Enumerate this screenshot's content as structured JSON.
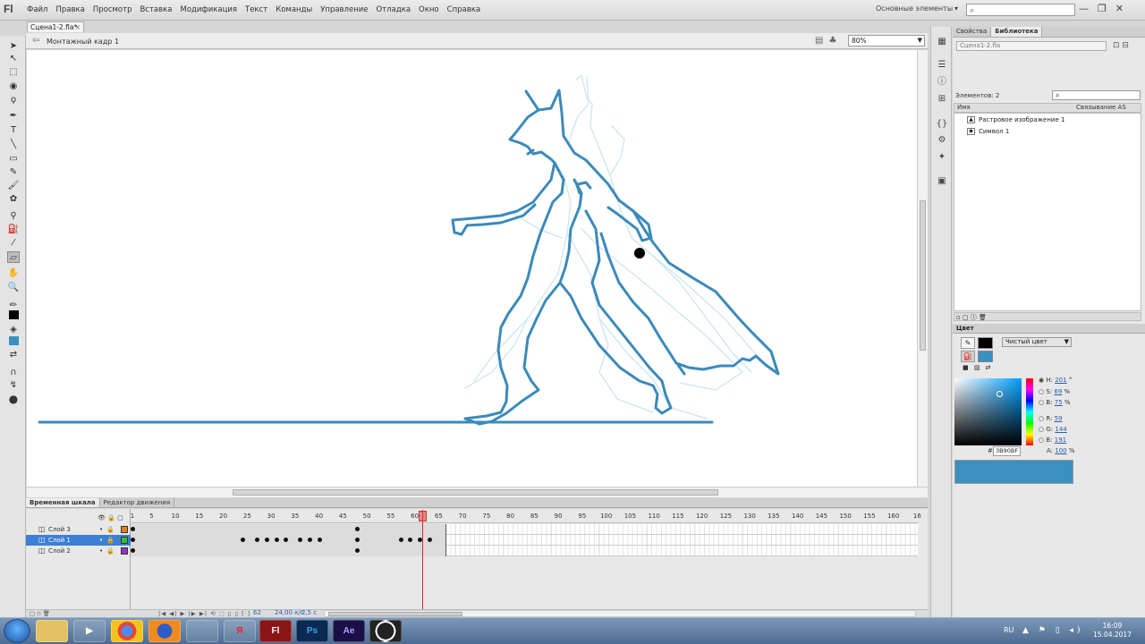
{
  "app": {
    "logo": "Fl"
  },
  "menu": [
    "Файл",
    "Правка",
    "Просмотр",
    "Вставка",
    "Модификация",
    "Текст",
    "Команды",
    "Управление",
    "Отладка",
    "Окно",
    "Справка"
  ],
  "workspace": {
    "label": "Основные элементы",
    "arrow": "▾"
  },
  "search": {
    "icon": "⌕"
  },
  "window_controls": {
    "minimize": "—",
    "restore": "❐",
    "close": "✕"
  },
  "document": {
    "tab": "Сцена1-2.fla*",
    "close": "×"
  },
  "edit_bar": {
    "breadcrumb": "Монтажный кадр 1",
    "zoom": "80%"
  },
  "timeline": {
    "tabs": [
      "Временная шкала",
      "Редактор движения"
    ],
    "ruler": [
      "1",
      "5",
      "10",
      "15",
      "20",
      "25",
      "30",
      "35",
      "40",
      "45",
      "50",
      "55",
      "60",
      "65",
      "70",
      "75",
      "80",
      "85",
      "90",
      "95",
      "100",
      "105",
      "110",
      "115",
      "120",
      "125",
      "130",
      "135",
      "140",
      "145",
      "150",
      "155",
      "160",
      "16"
    ],
    "layers": [
      {
        "name": "Слой 3",
        "color": "#e87d20",
        "selected": false
      },
      {
        "name": "Слой 1",
        "color": "#27c23a",
        "selected": true
      },
      {
        "name": "Слой 2",
        "color": "#9a2fd0",
        "selected": false
      }
    ],
    "current_frame": "62",
    "fps": "24,00 к/с",
    "time": "2,5 с"
  },
  "library": {
    "tabs": [
      "Свойства",
      "Библиотека"
    ],
    "file": "Сцена1-2.fla",
    "count": "Элементов: 2",
    "col_name": "Имя",
    "col_link": "Связывание AS",
    "items": [
      "Растровое изображение 1",
      "Символ 1"
    ]
  },
  "color_panel": {
    "title": "Цвет",
    "type": "Чистый цвет",
    "h_label": "H:",
    "h": "201",
    "h_unit": "°",
    "s_label": "S:",
    "s": "69",
    "s_unit": "%",
    "b_label": "B:",
    "b": "75",
    "b_unit": "%",
    "r_label": "R:",
    "r": "59",
    "g_label": "G:",
    "g": "144",
    "bl_label": "B:",
    "bl": "191",
    "a_label": "A:",
    "a": "100",
    "a_unit": "%",
    "hex_label": "#",
    "hex": "3B90BF",
    "stroke_color": "#000000",
    "fill_color": "#3b90bf"
  },
  "taskbar": {
    "apps": [
      "",
      "▶",
      "",
      "",
      "",
      "Я",
      "Fl",
      "Ps",
      "Ae",
      ""
    ],
    "lang": "RU",
    "tray": "▲ ⚑ ▯ ◂)",
    "time": "16:09",
    "date": "15.04.2017"
  },
  "colors": {
    "stroke_blue": "#3b8ab9",
    "onion_skin": "#c9e6ef"
  }
}
